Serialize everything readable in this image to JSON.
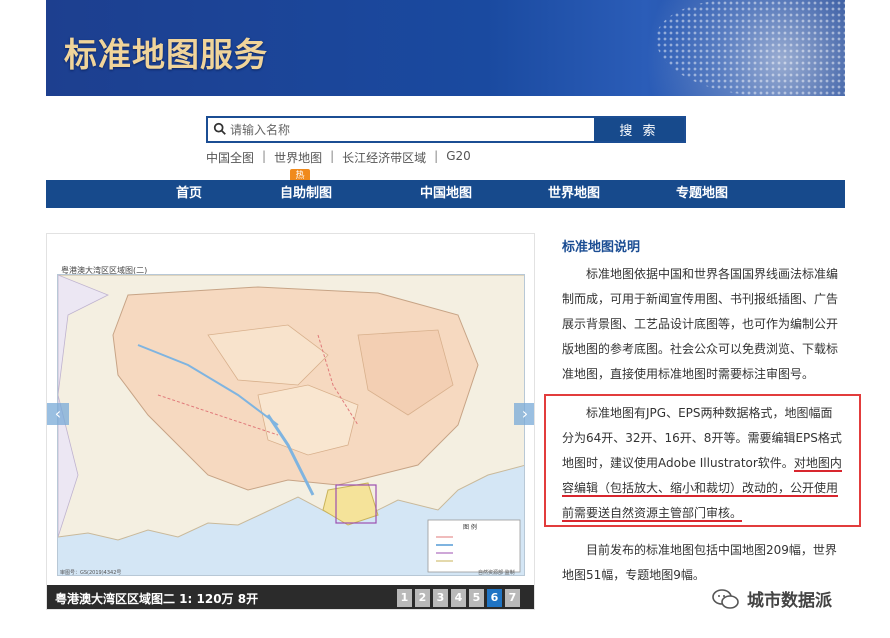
{
  "banner": {
    "title": "标准地图服务"
  },
  "search": {
    "placeholder": "请输入名称",
    "button": "搜 索"
  },
  "quick_links": [
    "中国全图",
    "世界地图",
    "长江经济带区域",
    "G20"
  ],
  "nav": {
    "items": [
      "首页",
      "自助制图",
      "中国地图",
      "世界地图",
      "专题地图"
    ],
    "hot_badge": "热"
  },
  "slider": {
    "map_title": "粤港澳大湾区区域图(二)",
    "caption": "粤港澳大湾区区域图二 1: 120万 8开",
    "pages": [
      "1",
      "2",
      "3",
      "4",
      "5",
      "6",
      "7"
    ],
    "active_page": "6",
    "prev": "‹",
    "next": "›",
    "map_legend_title": "图 例",
    "map_footer_left": "审图号：GS(2019)4342号",
    "map_footer_right": "自然资源部 监制"
  },
  "sidebar": {
    "title": "标准地图说明",
    "para1": "标准地图依据中国和世界各国国界线画法标准编制而成，可用于新闻宣传用图、书刊报纸插图、广告展示背景图、工艺品设计底图等，也可作为编制公开版地图的参考底图。社会公众可以免费浏览、下载标准地图，直接使用标准地图时需要标注审图号。",
    "para2_a": "标准地图有JPG、EPS两种数据格式，地图幅面分为64开、32开、16开、8开等。需要编辑EPS格式地图时，建议使用Adobe Illustrator软件。",
    "para2_b": "对地图内容编辑（包括放大、缩小和裁切）改动的，公开使用前需要送自然资源主管部门审核。",
    "para3": "目前发布的标准地图包括中国地图209幅，世界地图51幅，专题地图9幅。"
  },
  "watermark": {
    "text": "城市数据派"
  },
  "colors": {
    "brand_blue": "#174a8c",
    "hot_orange": "#f08a1c",
    "highlight_red": "#e23c3c",
    "active_page": "#1f74c4"
  }
}
